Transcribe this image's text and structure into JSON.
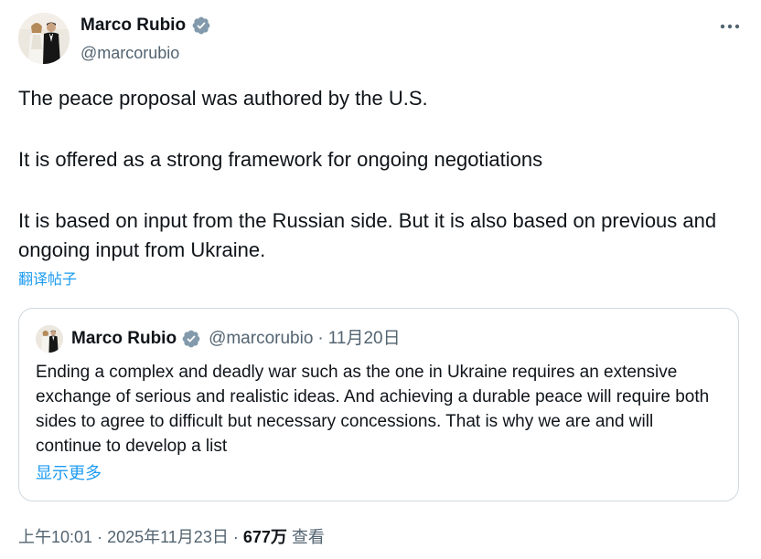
{
  "author": {
    "name": "Marco Rubio",
    "handle": "@marcorubio",
    "verified": true,
    "verified_color": "#829aab"
  },
  "tweet": {
    "paragraphs": [
      "The peace proposal was authored by the U.S.",
      "It is offered as a strong framework for ongoing negotiations",
      "It is based on input from the Russian side. But it is also based on previous and ongoing input from Ukraine."
    ],
    "translate_label": "翻译帖子"
  },
  "quote": {
    "name": "Marco Rubio",
    "handle": "@marcorubio",
    "separator": "·",
    "date": "11月20日",
    "text": "Ending a complex and deadly war such as the one in Ukraine requires an extensive exchange of serious and realistic ideas. And achieving a durable peace will require both sides to agree to difficult but necessary concessions. That is why we are and will continue to develop a list",
    "show_more_label": "显示更多"
  },
  "meta": {
    "time": "上午10:01",
    "separator": "·",
    "date": "2025年11月23日",
    "views_count": "677万",
    "views_label": "查看"
  },
  "colors": {
    "text": "#0f1419",
    "secondary": "#536471",
    "link": "#1d9bf0",
    "border": "#cfd9de"
  },
  "icons": {
    "more": "more-horizontal-icon",
    "verified": "verified-badge-icon"
  }
}
